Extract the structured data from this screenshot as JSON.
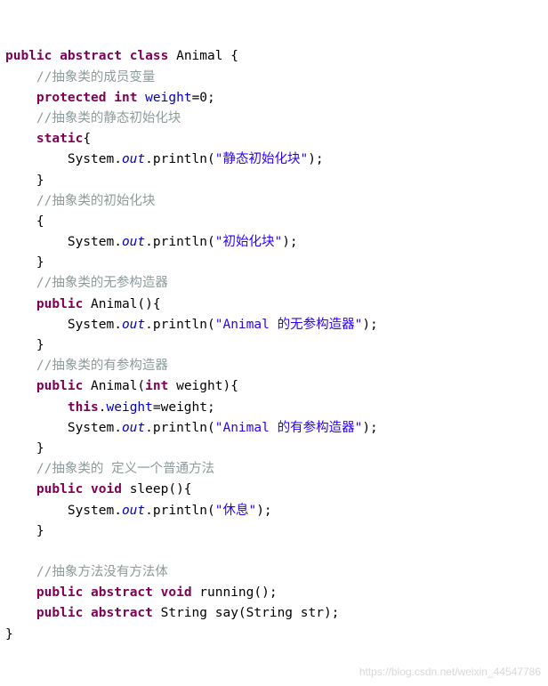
{
  "document": {
    "type": "java-source-code",
    "watermark": "https://blog.csdn.net/weixin_44547786",
    "lines": [
      [
        {
          "t": "public",
          "c": "kw"
        },
        {
          "t": " ",
          "c": "plain"
        },
        {
          "t": "abstract",
          "c": "kw"
        },
        {
          "t": " ",
          "c": "plain"
        },
        {
          "t": "class",
          "c": "kw"
        },
        {
          "t": " Animal {",
          "c": "plain"
        }
      ],
      [
        {
          "t": "    ",
          "c": "plain"
        },
        {
          "t": "//抽象类的成员变量",
          "c": "cmt"
        }
      ],
      [
        {
          "t": "    ",
          "c": "plain"
        },
        {
          "t": "protected",
          "c": "kw"
        },
        {
          "t": " ",
          "c": "plain"
        },
        {
          "t": "int",
          "c": "kw"
        },
        {
          "t": " ",
          "c": "plain"
        },
        {
          "t": "weight",
          "c": "field"
        },
        {
          "t": "=0;",
          "c": "plain"
        }
      ],
      [
        {
          "t": "    ",
          "c": "plain"
        },
        {
          "t": "//抽象类的静态初始化块",
          "c": "cmt"
        }
      ],
      [
        {
          "t": "    ",
          "c": "plain"
        },
        {
          "t": "static",
          "c": "kw"
        },
        {
          "t": "{",
          "c": "plain"
        }
      ],
      [
        {
          "t": "        System.",
          "c": "plain"
        },
        {
          "t": "out",
          "c": "fielditalic"
        },
        {
          "t": ".println(",
          "c": "plain"
        },
        {
          "t": "\"静态初始化块\"",
          "c": "str"
        },
        {
          "t": ");",
          "c": "plain"
        }
      ],
      [
        {
          "t": "    }",
          "c": "plain"
        }
      ],
      [
        {
          "t": "    ",
          "c": "plain"
        },
        {
          "t": "//抽象类的初始化块",
          "c": "cmt"
        }
      ],
      [
        {
          "t": "    {",
          "c": "plain"
        }
      ],
      [
        {
          "t": "        System.",
          "c": "plain"
        },
        {
          "t": "out",
          "c": "fielditalic"
        },
        {
          "t": ".println(",
          "c": "plain"
        },
        {
          "t": "\"初始化块\"",
          "c": "str"
        },
        {
          "t": ");",
          "c": "plain"
        }
      ],
      [
        {
          "t": "    }",
          "c": "plain"
        }
      ],
      [
        {
          "t": "    ",
          "c": "plain"
        },
        {
          "t": "//抽象类的无参构造器",
          "c": "cmt"
        }
      ],
      [
        {
          "t": "    ",
          "c": "plain"
        },
        {
          "t": "public",
          "c": "kw"
        },
        {
          "t": " Animal(){",
          "c": "plain"
        }
      ],
      [
        {
          "t": "        System.",
          "c": "plain"
        },
        {
          "t": "out",
          "c": "fielditalic"
        },
        {
          "t": ".println(",
          "c": "plain"
        },
        {
          "t": "\"Animal ",
          "c": "str"
        },
        {
          "t": "的无参构造器\"",
          "c": "str"
        },
        {
          "t": ");",
          "c": "plain"
        }
      ],
      [
        {
          "t": "    }",
          "c": "plain"
        }
      ],
      [
        {
          "t": "    ",
          "c": "plain"
        },
        {
          "t": "//抽象类的有参构造器",
          "c": "cmt"
        }
      ],
      [
        {
          "t": "    ",
          "c": "plain"
        },
        {
          "t": "public",
          "c": "kw"
        },
        {
          "t": " Animal(",
          "c": "plain"
        },
        {
          "t": "int",
          "c": "kw"
        },
        {
          "t": " weight){",
          "c": "plain"
        }
      ],
      [
        {
          "t": "        ",
          "c": "plain"
        },
        {
          "t": "this",
          "c": "kw"
        },
        {
          "t": ".",
          "c": "plain"
        },
        {
          "t": "weight",
          "c": "field"
        },
        {
          "t": "=weight;",
          "c": "plain"
        }
      ],
      [
        {
          "t": "        System.",
          "c": "plain"
        },
        {
          "t": "out",
          "c": "fielditalic"
        },
        {
          "t": ".println(",
          "c": "plain"
        },
        {
          "t": "\"Animal ",
          "c": "str"
        },
        {
          "t": "的有参构造器\"",
          "c": "str"
        },
        {
          "t": ");",
          "c": "plain"
        }
      ],
      [
        {
          "t": "    }",
          "c": "plain"
        }
      ],
      [
        {
          "t": "    ",
          "c": "plain"
        },
        {
          "t": "//抽象类的 定义一个普通方法",
          "c": "cmt"
        }
      ],
      [
        {
          "t": "    ",
          "c": "plain"
        },
        {
          "t": "public",
          "c": "kw"
        },
        {
          "t": " ",
          "c": "plain"
        },
        {
          "t": "void",
          "c": "kw"
        },
        {
          "t": " sleep(){",
          "c": "plain"
        }
      ],
      [
        {
          "t": "        System.",
          "c": "plain"
        },
        {
          "t": "out",
          "c": "fielditalic"
        },
        {
          "t": ".println(",
          "c": "plain"
        },
        {
          "t": "\"休息\"",
          "c": "str"
        },
        {
          "t": ");",
          "c": "plain"
        }
      ],
      [
        {
          "t": "    }",
          "c": "plain"
        }
      ],
      [
        {
          "t": "",
          "c": "plain"
        }
      ],
      [
        {
          "t": "    ",
          "c": "plain"
        },
        {
          "t": "//抽象方法没有方法体",
          "c": "cmt"
        }
      ],
      [
        {
          "t": "    ",
          "c": "plain"
        },
        {
          "t": "public",
          "c": "kw"
        },
        {
          "t": " ",
          "c": "plain"
        },
        {
          "t": "abstract",
          "c": "kw"
        },
        {
          "t": " ",
          "c": "plain"
        },
        {
          "t": "void",
          "c": "kw"
        },
        {
          "t": " running();",
          "c": "plain"
        }
      ],
      [
        {
          "t": "    ",
          "c": "plain"
        },
        {
          "t": "public",
          "c": "kw"
        },
        {
          "t": " ",
          "c": "plain"
        },
        {
          "t": "abstract",
          "c": "kw"
        },
        {
          "t": " String say(String str);",
          "c": "plain"
        }
      ],
      [
        {
          "t": "}",
          "c": "plain"
        }
      ]
    ]
  }
}
